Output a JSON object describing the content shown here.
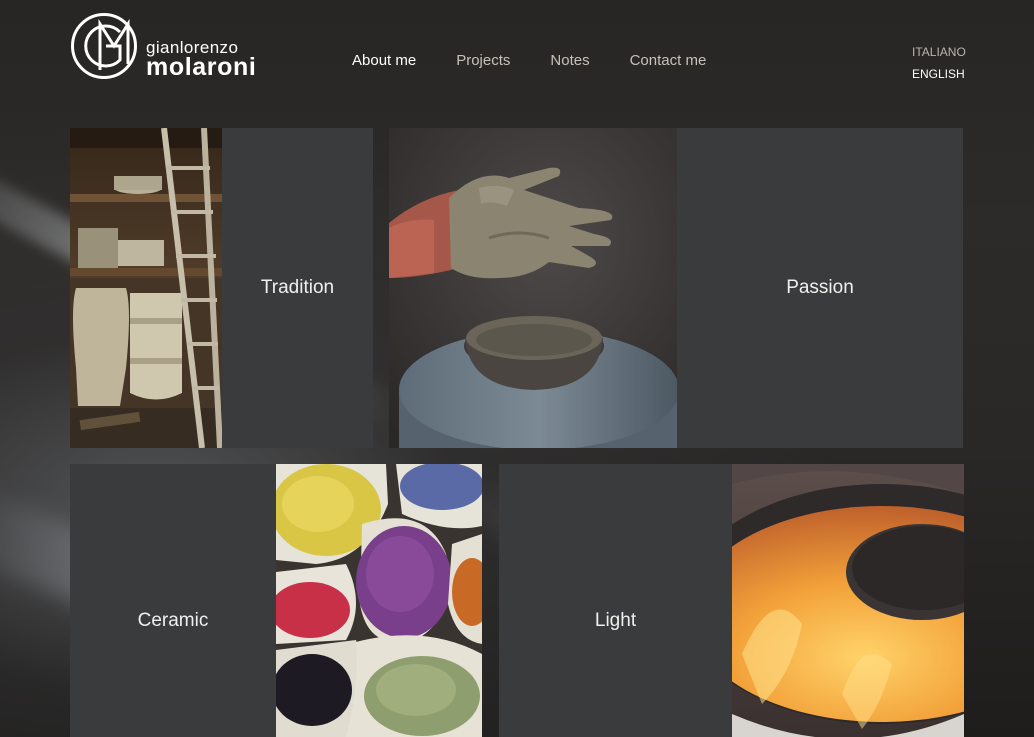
{
  "brand": {
    "first_name": "gianlorenzo",
    "last_name": "molaroni",
    "monogram": "GM"
  },
  "nav": {
    "items": [
      {
        "label": "About me",
        "active": true
      },
      {
        "label": "Projects",
        "active": false
      },
      {
        "label": "Notes",
        "active": false
      },
      {
        "label": "Contact me",
        "active": false
      }
    ]
  },
  "lang": {
    "italiano": "ITALIANO",
    "english": "ENGLISH",
    "selected": "ENGLISH"
  },
  "tiles": [
    {
      "label": "Tradition",
      "image": "pottery-shelves-ladder"
    },
    {
      "label": "Passion",
      "image": "clay-hand-bowl"
    },
    {
      "label": "Ceramic",
      "image": "pigment-powder-bags"
    },
    {
      "label": "Light",
      "image": "glowing-kiln"
    }
  ],
  "colors": {
    "background": "#262422",
    "tile": "#393b3c",
    "nav_active": "#ffffff",
    "nav_inactive": "#c6c2b8"
  }
}
